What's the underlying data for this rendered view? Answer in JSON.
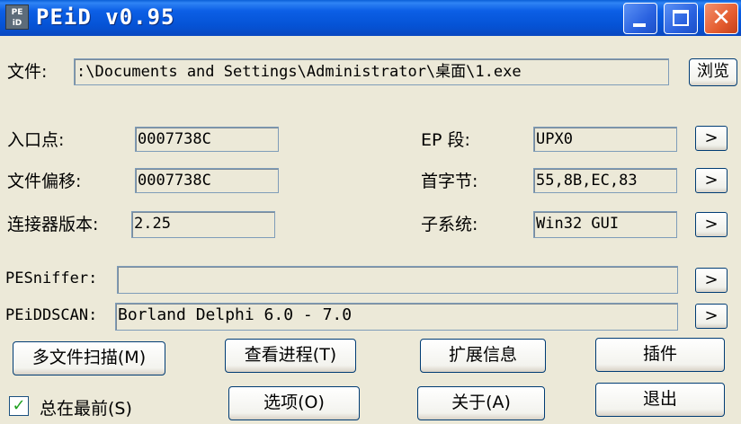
{
  "window": {
    "title": "PEiD v0.95",
    "app_icon_text": "PE iD",
    "controls": {
      "close_glyph": "✕"
    }
  },
  "file": {
    "label": "文件:",
    "path": ":\\Documents and Settings\\Administrator\\桌面\\1.exe",
    "browse_label": "浏览"
  },
  "info": {
    "entry_point_label": "入口点:",
    "entry_point_value": "0007738C",
    "file_offset_label": "文件偏移:",
    "file_offset_value": "0007738C",
    "linker_label": "连接器版本:",
    "linker_value": "2.25",
    "ep_section_label": "EP 段:",
    "ep_section_value": "UPX0",
    "first_bytes_label": "首字节:",
    "first_bytes_value": "55,8B,EC,83",
    "subsystem_label": "子系统:",
    "subsystem_value": "Win32 GUI"
  },
  "detection": {
    "pesniffer_label": "PESniffer:",
    "pesniffer_value": "",
    "peiddscan_label": "PEiDDSCAN:",
    "peiddscan_value": "Borland Delphi 6.0 - 7.0"
  },
  "arrow_glyph": ">",
  "buttons": {
    "multi_scan": "多文件扫描(M)",
    "task_viewer": "查看进程(T)",
    "ext_info": "扩展信息",
    "plugins": "插件",
    "options": "选项(O)",
    "about": "关于(A)",
    "exit": "退出"
  },
  "stay_on_top": {
    "label": "总在最前(S)",
    "checked": true,
    "check_glyph": "✓"
  }
}
